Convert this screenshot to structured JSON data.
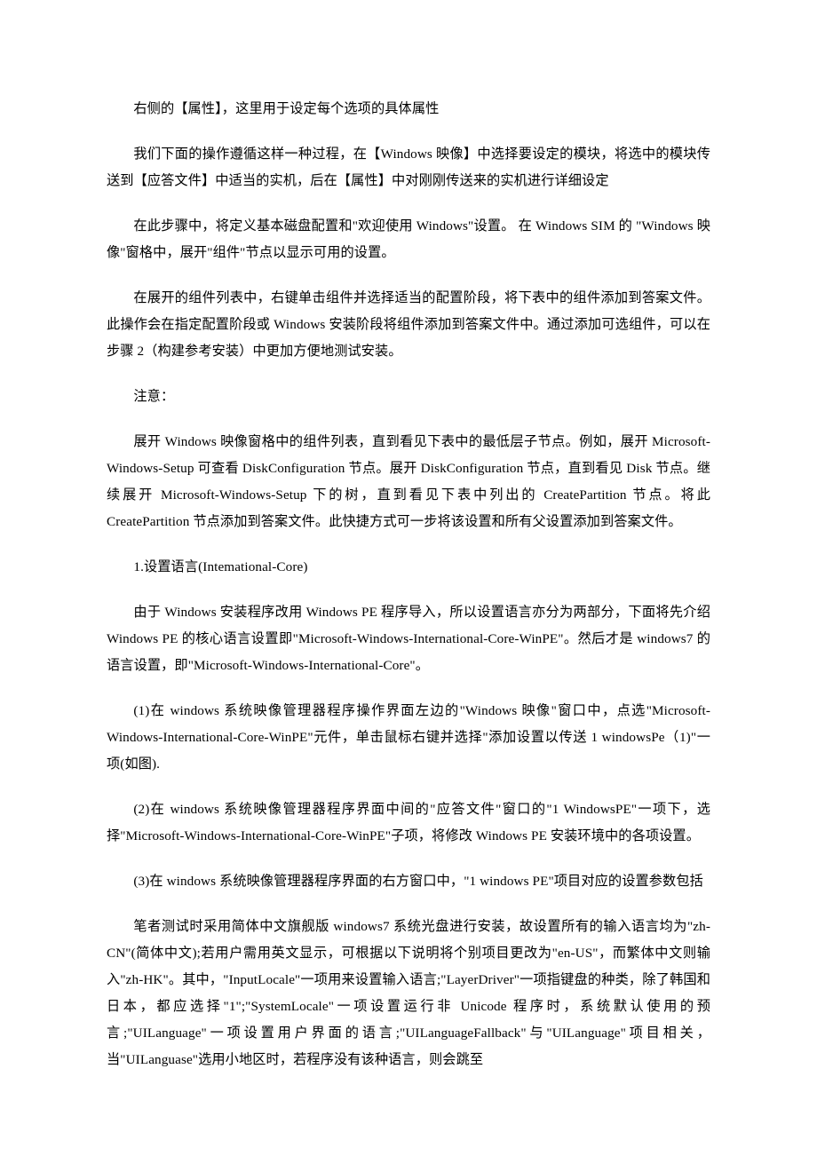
{
  "document": {
    "page_background": "#ffffff",
    "text_color": "#000000",
    "blocks": [
      {
        "id": "p1",
        "type": "paragraph",
        "text": "右侧的【属性】，这里用于设定每个选项的具体属性"
      },
      {
        "id": "p2",
        "type": "paragraph",
        "text": "我们下面的操作遵循这样一种过程，在【Windows 映像】中选择要设定的模块，将选中的模块传送到【应答文件】中适当的实机，后在【属性】中对刚刚传送来的实机进行详细设定"
      },
      {
        "id": "p3",
        "type": "paragraph",
        "text": "在此步骤中，将定义基本磁盘配置和\"欢迎使用 Windows\"设置。 在 Windows SIM 的 \"Windows 映像\"窗格中，展开\"组件\"节点以显示可用的设置。"
      },
      {
        "id": "p4",
        "type": "paragraph",
        "text": "在展开的组件列表中，右键单击组件并选择适当的配置阶段，将下表中的组件添加到答案文件。此操作会在指定配置阶段或 Windows 安装阶段将组件添加到答案文件中。通过添加可选组件，可以在步骤 2（构建参考安装）中更加方便地测试安装。"
      },
      {
        "id": "p5",
        "type": "paragraph",
        "text": "注意："
      },
      {
        "id": "p6",
        "type": "paragraph",
        "text": "展开 Windows 映像窗格中的组件列表，直到看见下表中的最低层子节点。例如，展开 Microsoft-Windows-Setup 可查看 DiskConfiguration 节点。展开 DiskConfiguration 节点，直到看见 Disk 节点。继续展开 Microsoft-Windows-Setup 下的树，直到看见下表中列出的 CreatePartition 节点。将此 CreatePartition 节点添加到答案文件。此快捷方式可一步将该设置和所有父设置添加到答案文件。"
      },
      {
        "id": "p7",
        "type": "heading",
        "text": "1.设置语言(Intemational-Core)"
      },
      {
        "id": "p8",
        "type": "paragraph",
        "text": "由于 Windows 安装程序改用 Windows PE 程序导入，所以设置语言亦分为两部分，下面将先介绍 Windows PE 的核心语言设置即\"Microsoft-Windows-International-Core-WinPE\"。然后才是 windows7 的语言设置，即\"Microsoft-Windows-International-Core\"。"
      },
      {
        "id": "p9",
        "type": "paragraph",
        "text": "(1)在 windows 系统映像管理器程序操作界面左边的\"Windows 映像\"窗口中，点选\"Microsoft-Windows-International-Core-WinPE\"元件，单击鼠标右键并选择\"添加设置以传送 1 windowsPe（1)\"一项(如图)."
      },
      {
        "id": "p10",
        "type": "paragraph",
        "text": "(2)在 windows 系统映像管理器程序界面中间的\"应答文件\"窗口的\"1 WindowsPE\"一项下，选择\"Microsoft-Windows-International-Core-WinPE\"子项，将修改 Windows PE 安装环境中的各项设置。"
      },
      {
        "id": "p11",
        "type": "paragraph",
        "text": "(3)在 windows 系统映像管理器程序界面的右方窗口中，\"1 windows PE\"项目对应的设置参数包括"
      },
      {
        "id": "p12",
        "type": "paragraph",
        "text": "笔者测试时采用简体中文旗舰版 windows7 系统光盘进行安装，故设置所有的输入语言均为\"zh-CN\"(简体中文);若用户需用英文显示，可根据以下说明将个别项目更改为\"en-US\"，而繁体中文则输入\"zh-HK\"。其中，\"InputLocale\"一项用来设置输入语言;\"LayerDriver\"一项指键盘的种类，除了韩国和日本，都应选择\"1\";\"SystemLocale\"一项设置运行非 Unicode 程序时，系统默认使用的预言;\"UILanguage\"一项设置用户界面的语言;\"UILanguageFallback\"与\"UILanguage\"项目相关，当\"UILanguase\"选用小地区时，若程序没有该种语言，则会跳至"
      }
    ]
  }
}
